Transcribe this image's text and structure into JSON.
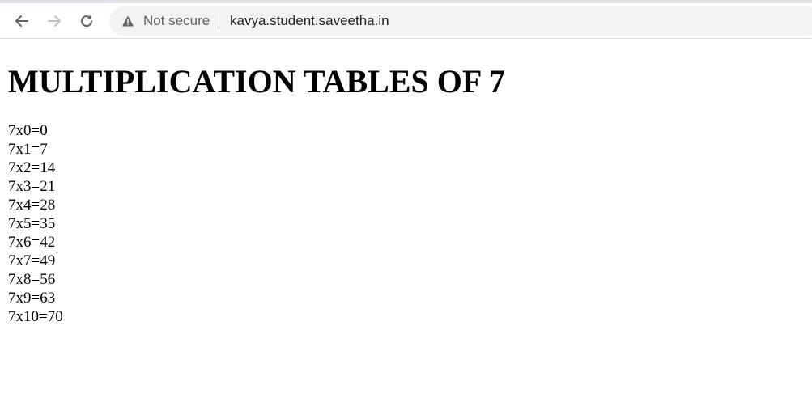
{
  "browser": {
    "security_label": "Not secure",
    "url": "kavya.student.saveetha.in",
    "icons": [
      "back-arrow-icon",
      "forward-arrow-icon",
      "reload-icon",
      "warning-icon"
    ]
  },
  "page": {
    "heading": "MULTIPLICATION TABLES OF 7",
    "lines": [
      "7x0=0",
      "7x1=7",
      "7x2=14",
      "7x3=21",
      "7x4=28",
      "7x5=35",
      "7x6=42",
      "7x7=49",
      "7x8=56",
      "7x9=63",
      "7x10=70"
    ]
  }
}
